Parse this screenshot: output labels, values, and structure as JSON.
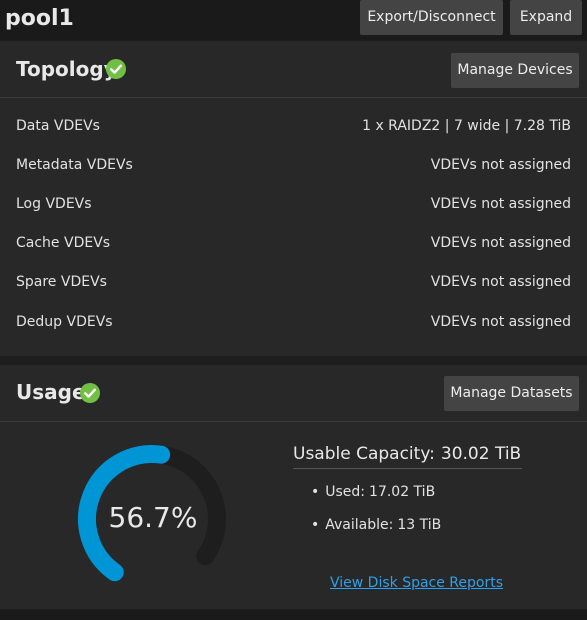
{
  "header": {
    "pool_name": "pool1",
    "export_label": "Export/Disconnect",
    "expand_label": "Expand"
  },
  "topology": {
    "title": "Topology",
    "manage_label": "Manage Devices",
    "status_icon": "check-circle-icon",
    "rows": [
      {
        "label": "Data VDEVs",
        "value": "1 x RAIDZ2 | 7 wide | 7.28 TiB"
      },
      {
        "label": "Metadata VDEVs",
        "value": "VDEVs not assigned"
      },
      {
        "label": "Log VDEVs",
        "value": "VDEVs not assigned"
      },
      {
        "label": "Cache VDEVs",
        "value": "VDEVs not assigned"
      },
      {
        "label": "Spare VDEVs",
        "value": "VDEVs not assigned"
      },
      {
        "label": "Dedup VDEVs",
        "value": "VDEVs not assigned"
      }
    ]
  },
  "usage": {
    "title": "Usage",
    "manage_label": "Manage Datasets",
    "status_icon": "check-circle-icon",
    "percent_label": "56.7%",
    "percent_used": 56.7,
    "capacity_label": "Usable Capacity:",
    "capacity_value": "30.02 TiB",
    "used_label": "Used:",
    "used_value": "17.02 TiB",
    "available_label": "Available:",
    "available_value": "13 TiB",
    "report_link": "View Disk Space Reports"
  },
  "colors": {
    "accent_blue": "#0095d5",
    "status_green": "#71bf44",
    "link": "#2fa0e8"
  }
}
